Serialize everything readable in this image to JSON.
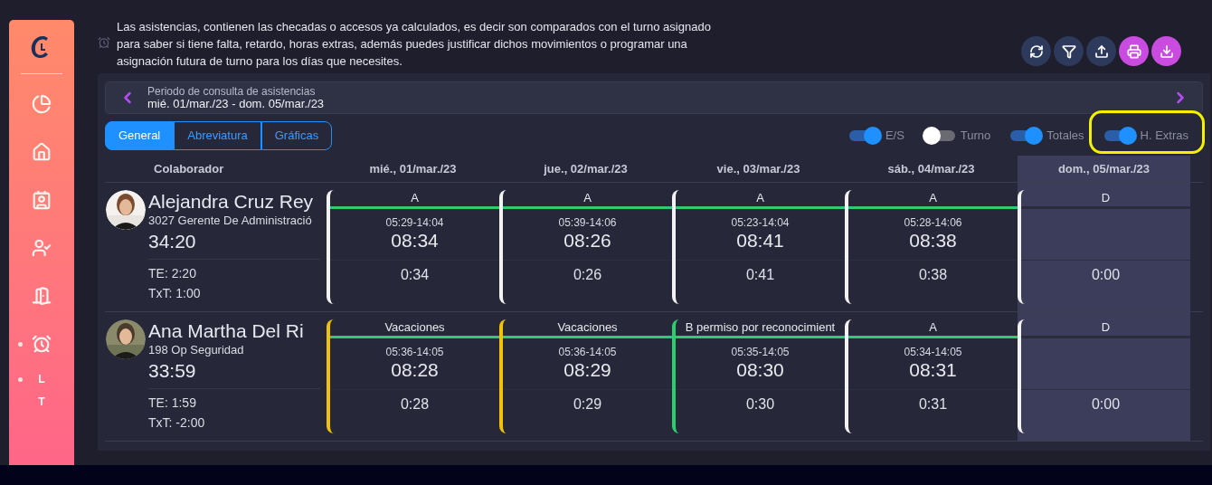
{
  "description": "Las asistencias, contienen las checadas o accesos ya calculados, es decir son comparados con el turno asignado para saber si tiene falta, retardo, horas extras, además puedes justificar dichos movimientos o programar una asignación futura de turno para los días que necesites.",
  "toolbar": [
    {
      "color": "#2d3a5c"
    },
    {
      "color": "#2d3a5c"
    },
    {
      "color": "#2d3a5c"
    },
    {
      "color": "#c94be0"
    },
    {
      "color": "#c94be0"
    }
  ],
  "sidebar": {
    "items": [
      {
        "kind": "icon",
        "marked": false
      },
      {
        "kind": "icon",
        "marked": false
      },
      {
        "kind": "icon",
        "marked": false
      },
      {
        "kind": "icon",
        "marked": false
      },
      {
        "kind": "icon",
        "marked": false
      },
      {
        "kind": "icon",
        "marked": true
      },
      {
        "kind": "letter",
        "label": "L",
        "marked": true
      },
      {
        "kind": "letter",
        "label": "T",
        "marked": false
      }
    ]
  },
  "period": {
    "title": "Periodo de consulta de asistencias",
    "range": "mié. 01/mar./23 - dom. 05/mar./23"
  },
  "tabs": [
    {
      "label": "General",
      "selected": true
    },
    {
      "label": "Abreviatura",
      "selected": false
    },
    {
      "label": "Gráficas",
      "selected": false
    }
  ],
  "toggles": [
    {
      "label": "E/S",
      "on": true
    },
    {
      "label": "Turno",
      "on": false
    },
    {
      "label": "Totales",
      "on": true
    },
    {
      "label": "H. Extras",
      "on": true
    }
  ],
  "callout": {
    "color": "#f5f200"
  },
  "columns": {
    "collaborator": "Colaborador",
    "days": [
      {
        "label": "mié., 01/mar./23",
        "highlighted": false
      },
      {
        "label": "jue., 02/mar./23",
        "highlighted": false
      },
      {
        "label": "vie., 03/mar./23",
        "highlighted": false
      },
      {
        "label": "sáb., 04/mar./23",
        "highlighted": false
      },
      {
        "label": "dom., 05/mar./23",
        "highlighted": true
      }
    ]
  },
  "rows": [
    {
      "name": "Alejandra Cruz Rey",
      "position": "3027 Gerente De Administració",
      "total": "34:20",
      "te": "TE: 2:20",
      "txt": "TxT: 1:00",
      "cells": [
        {
          "kind": "work",
          "label": "A",
          "color": "#f2f2f2",
          "times": "05:29-14:04",
          "hours": "08:34",
          "extra": "0:34"
        },
        {
          "kind": "work",
          "label": "A",
          "color": "#f2f2f2",
          "times": "05:39-14:06",
          "hours": "08:26",
          "extra": "0:26"
        },
        {
          "kind": "work",
          "label": "A",
          "color": "#f2f2f2",
          "times": "05:23-14:04",
          "hours": "08:41",
          "extra": "0:41"
        },
        {
          "kind": "work",
          "label": "A",
          "color": "#f2f2f2",
          "times": "05:28-14:06",
          "hours": "08:38",
          "extra": "0:38"
        },
        {
          "kind": "rest",
          "label": "D",
          "color": "#f2f2f2",
          "extra": "0:00"
        }
      ]
    },
    {
      "name": "Ana Martha Del Ri",
      "position": "198 Op Seguridad",
      "total": "33:59",
      "te": "TE: 1:59",
      "txt": "TxT: -2:00",
      "cells": [
        {
          "kind": "work",
          "label": "Vacaciones",
          "color": "#f0c20c",
          "times": "05:36-14:05",
          "hours": "08:28",
          "extra": "0:28"
        },
        {
          "kind": "work",
          "label": "Vacaciones",
          "color": "#f0c20c",
          "times": "05:36-14:05",
          "hours": "08:29",
          "extra": "0:29"
        },
        {
          "kind": "work",
          "label": "B permiso por reconocimient",
          "color": "#2ecc71",
          "times": "05:35-14:05",
          "hours": "08:30",
          "extra": "0:30"
        },
        {
          "kind": "work",
          "label": "A",
          "color": "#f2f2f2",
          "times": "05:34-14:05",
          "hours": "08:31",
          "extra": "0:31"
        },
        {
          "kind": "rest",
          "label": "D",
          "color": "#f2f2f2",
          "extra": "0:00"
        }
      ]
    }
  ]
}
